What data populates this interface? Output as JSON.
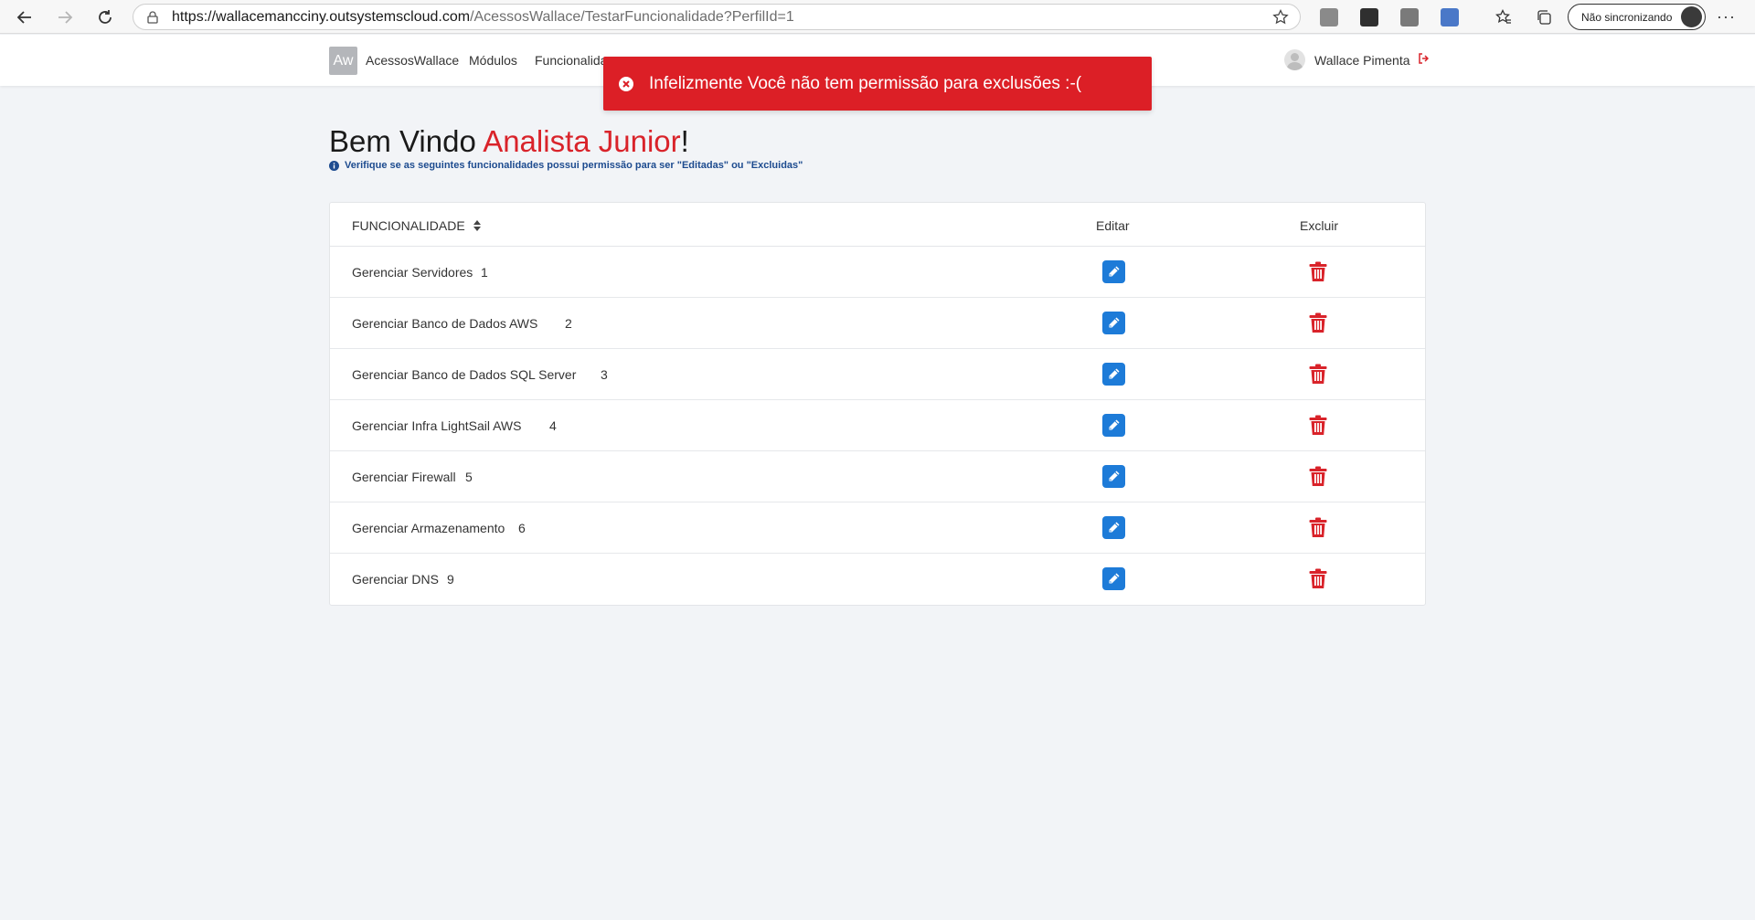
{
  "browser": {
    "url_domain": "https://wallacemancciny.outsystemscloud.com",
    "url_path": "/AcessosWallace/TestarFuncionalidade?PerfilId=1",
    "sync_label": "Não sincronizando"
  },
  "header": {
    "logo_text": "Aw",
    "menu": [
      "AcessosWallace",
      "Módulos",
      "Funcionalida"
    ],
    "user_name": "Wallace Pimenta"
  },
  "toast": {
    "message": "Infelizmente Você não tem permissão para exclusões :-("
  },
  "page": {
    "title_prefix": "Bem Vindo ",
    "title_role": "Analista Junior",
    "title_suffix": "!",
    "subtitle": "Verifique se as seguintes funcionalidades possui permissão para ser \"Editadas\" ou \"Excluidas\""
  },
  "table": {
    "columns": [
      "FUNCIONALIDADE",
      "Editar",
      "Excluir"
    ],
    "rows": [
      {
        "name": "Gerenciar Servidores",
        "id": "1"
      },
      {
        "name": "Gerenciar Banco de Dados AWS",
        "id": "2"
      },
      {
        "name": "Gerenciar Banco de Dados SQL Server",
        "id": "3"
      },
      {
        "name": "Gerenciar Infra LightSail AWS",
        "id": "4"
      },
      {
        "name": "Gerenciar Firewall",
        "id": "5"
      },
      {
        "name": "Gerenciar Armazenamento",
        "id": "6"
      },
      {
        "name": "Gerenciar DNS",
        "id": "9"
      }
    ]
  },
  "colors": {
    "accent_red": "#dc1f26",
    "edit_blue": "#1d7bd8",
    "delete_red": "#d9232a"
  }
}
